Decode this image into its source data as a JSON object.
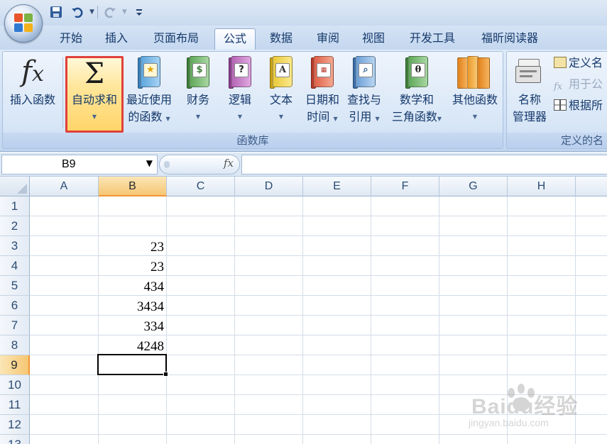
{
  "tabs": [
    {
      "label": "开始"
    },
    {
      "label": "插入"
    },
    {
      "label": "页面布局"
    },
    {
      "label": "公式",
      "active": true
    },
    {
      "label": "数据"
    },
    {
      "label": "审阅"
    },
    {
      "label": "视图"
    },
    {
      "label": "开发工具"
    },
    {
      "label": "福昕阅读器"
    }
  ],
  "ribbon": {
    "function_library": {
      "label": "函数库",
      "insert_function": {
        "label": "插入函数",
        "icon": "fx-icon"
      },
      "autosum": {
        "label": "自动求和",
        "icon": "sigma-icon",
        "highlighted": true,
        "highlight_color": "#e0403a"
      },
      "recently_used": {
        "line1": "最近使用",
        "line2": "的函数",
        "icon": "star-book-icon"
      },
      "financial": {
        "label": "财务",
        "icon": "money-book-icon"
      },
      "logical": {
        "label": "逻辑",
        "icon": "question-book-icon"
      },
      "text": {
        "label": "文本",
        "icon": "letter-a-book-icon"
      },
      "date_time": {
        "line1": "日期和",
        "line2": "时间",
        "icon": "calendar-book-icon"
      },
      "lookup_reference": {
        "line1": "查找与",
        "line2": "引用",
        "icon": "magnifier-book-icon"
      },
      "math_trig": {
        "line1": "数学和",
        "line2": "三角函数",
        "icon": "theta-book-icon"
      },
      "more_functions": {
        "label": "其他函数",
        "icon": "stacked-books-icon"
      }
    },
    "defined_names": {
      "label": "定义的名",
      "name_manager": {
        "line1": "名称",
        "line2": "管理器",
        "icon": "name-manager-icon"
      },
      "define_name": {
        "label": "定义名"
      },
      "use_in_formula": {
        "label": "用于公"
      },
      "create_from_selection": {
        "label": "根据所"
      }
    }
  },
  "formula_bar": {
    "name_box": "B9",
    "fx_label": "fx",
    "formula": ""
  },
  "sheet": {
    "columns": [
      "A",
      "B",
      "C",
      "D",
      "E",
      "F",
      "G",
      "H"
    ],
    "selected_column": "B",
    "rows": [
      "1",
      "2",
      "3",
      "4",
      "5",
      "6",
      "7",
      "8",
      "9",
      "10",
      "11",
      "12",
      "13"
    ],
    "selected_row": "9",
    "active_cell": "B9",
    "cells": [
      {
        "ref": "B3",
        "value": "23"
      },
      {
        "ref": "B4",
        "value": "23"
      },
      {
        "ref": "B5",
        "value": "434"
      },
      {
        "ref": "B6",
        "value": "3434"
      },
      {
        "ref": "B7",
        "value": "334"
      },
      {
        "ref": "B8",
        "value": "4248"
      }
    ]
  },
  "watermark": {
    "text": "Baidu经验",
    "url": "jingyan.baidu.com"
  }
}
